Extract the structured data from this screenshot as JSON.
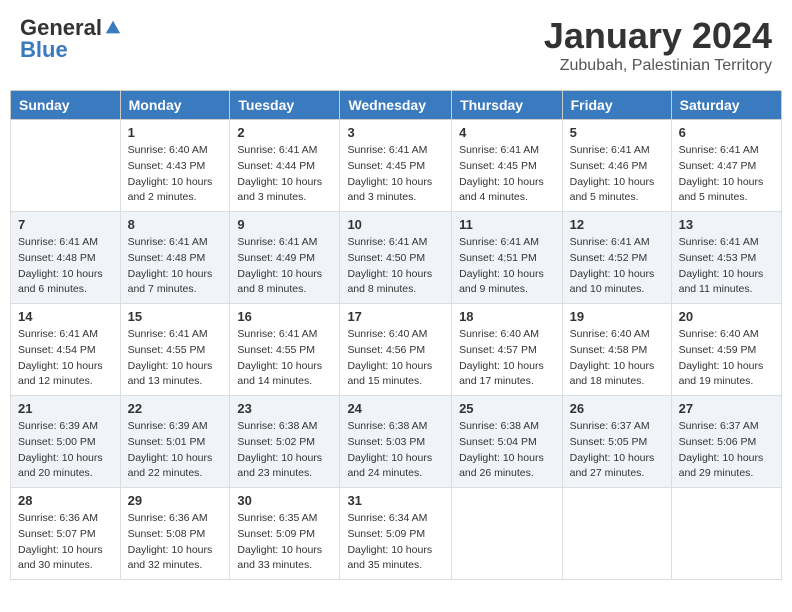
{
  "header": {
    "logo_general": "General",
    "logo_blue": "Blue",
    "month": "January 2024",
    "location": "Zububah, Palestinian Territory"
  },
  "days_of_week": [
    "Sunday",
    "Monday",
    "Tuesday",
    "Wednesday",
    "Thursday",
    "Friday",
    "Saturday"
  ],
  "weeks": [
    [
      {
        "day": "",
        "info": ""
      },
      {
        "day": "1",
        "info": "Sunrise: 6:40 AM\nSunset: 4:43 PM\nDaylight: 10 hours\nand 2 minutes."
      },
      {
        "day": "2",
        "info": "Sunrise: 6:41 AM\nSunset: 4:44 PM\nDaylight: 10 hours\nand 3 minutes."
      },
      {
        "day": "3",
        "info": "Sunrise: 6:41 AM\nSunset: 4:45 PM\nDaylight: 10 hours\nand 3 minutes."
      },
      {
        "day": "4",
        "info": "Sunrise: 6:41 AM\nSunset: 4:45 PM\nDaylight: 10 hours\nand 4 minutes."
      },
      {
        "day": "5",
        "info": "Sunrise: 6:41 AM\nSunset: 4:46 PM\nDaylight: 10 hours\nand 5 minutes."
      },
      {
        "day": "6",
        "info": "Sunrise: 6:41 AM\nSunset: 4:47 PM\nDaylight: 10 hours\nand 5 minutes."
      }
    ],
    [
      {
        "day": "7",
        "info": "Sunrise: 6:41 AM\nSunset: 4:48 PM\nDaylight: 10 hours\nand 6 minutes."
      },
      {
        "day": "8",
        "info": "Sunrise: 6:41 AM\nSunset: 4:48 PM\nDaylight: 10 hours\nand 7 minutes."
      },
      {
        "day": "9",
        "info": "Sunrise: 6:41 AM\nSunset: 4:49 PM\nDaylight: 10 hours\nand 8 minutes."
      },
      {
        "day": "10",
        "info": "Sunrise: 6:41 AM\nSunset: 4:50 PM\nDaylight: 10 hours\nand 8 minutes."
      },
      {
        "day": "11",
        "info": "Sunrise: 6:41 AM\nSunset: 4:51 PM\nDaylight: 10 hours\nand 9 minutes."
      },
      {
        "day": "12",
        "info": "Sunrise: 6:41 AM\nSunset: 4:52 PM\nDaylight: 10 hours\nand 10 minutes."
      },
      {
        "day": "13",
        "info": "Sunrise: 6:41 AM\nSunset: 4:53 PM\nDaylight: 10 hours\nand 11 minutes."
      }
    ],
    [
      {
        "day": "14",
        "info": "Sunrise: 6:41 AM\nSunset: 4:54 PM\nDaylight: 10 hours\nand 12 minutes."
      },
      {
        "day": "15",
        "info": "Sunrise: 6:41 AM\nSunset: 4:55 PM\nDaylight: 10 hours\nand 13 minutes."
      },
      {
        "day": "16",
        "info": "Sunrise: 6:41 AM\nSunset: 4:55 PM\nDaylight: 10 hours\nand 14 minutes."
      },
      {
        "day": "17",
        "info": "Sunrise: 6:40 AM\nSunset: 4:56 PM\nDaylight: 10 hours\nand 15 minutes."
      },
      {
        "day": "18",
        "info": "Sunrise: 6:40 AM\nSunset: 4:57 PM\nDaylight: 10 hours\nand 17 minutes."
      },
      {
        "day": "19",
        "info": "Sunrise: 6:40 AM\nSunset: 4:58 PM\nDaylight: 10 hours\nand 18 minutes."
      },
      {
        "day": "20",
        "info": "Sunrise: 6:40 AM\nSunset: 4:59 PM\nDaylight: 10 hours\nand 19 minutes."
      }
    ],
    [
      {
        "day": "21",
        "info": "Sunrise: 6:39 AM\nSunset: 5:00 PM\nDaylight: 10 hours\nand 20 minutes."
      },
      {
        "day": "22",
        "info": "Sunrise: 6:39 AM\nSunset: 5:01 PM\nDaylight: 10 hours\nand 22 minutes."
      },
      {
        "day": "23",
        "info": "Sunrise: 6:38 AM\nSunset: 5:02 PM\nDaylight: 10 hours\nand 23 minutes."
      },
      {
        "day": "24",
        "info": "Sunrise: 6:38 AM\nSunset: 5:03 PM\nDaylight: 10 hours\nand 24 minutes."
      },
      {
        "day": "25",
        "info": "Sunrise: 6:38 AM\nSunset: 5:04 PM\nDaylight: 10 hours\nand 26 minutes."
      },
      {
        "day": "26",
        "info": "Sunrise: 6:37 AM\nSunset: 5:05 PM\nDaylight: 10 hours\nand 27 minutes."
      },
      {
        "day": "27",
        "info": "Sunrise: 6:37 AM\nSunset: 5:06 PM\nDaylight: 10 hours\nand 29 minutes."
      }
    ],
    [
      {
        "day": "28",
        "info": "Sunrise: 6:36 AM\nSunset: 5:07 PM\nDaylight: 10 hours\nand 30 minutes."
      },
      {
        "day": "29",
        "info": "Sunrise: 6:36 AM\nSunset: 5:08 PM\nDaylight: 10 hours\nand 32 minutes."
      },
      {
        "day": "30",
        "info": "Sunrise: 6:35 AM\nSunset: 5:09 PM\nDaylight: 10 hours\nand 33 minutes."
      },
      {
        "day": "31",
        "info": "Sunrise: 6:34 AM\nSunset: 5:09 PM\nDaylight: 10 hours\nand 35 minutes."
      },
      {
        "day": "",
        "info": ""
      },
      {
        "day": "",
        "info": ""
      },
      {
        "day": "",
        "info": ""
      }
    ]
  ]
}
